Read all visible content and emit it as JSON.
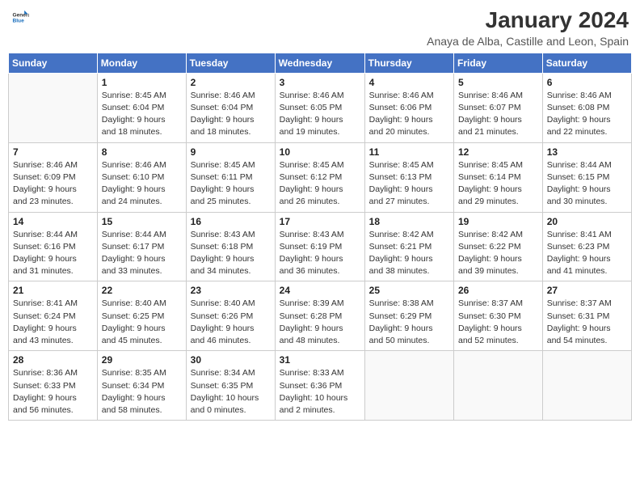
{
  "logo": {
    "general": "General",
    "blue": "Blue"
  },
  "header": {
    "month_year": "January 2024",
    "subtitle": "Anaya de Alba, Castille and Leon, Spain"
  },
  "weekdays": [
    "Sunday",
    "Monday",
    "Tuesday",
    "Wednesday",
    "Thursday",
    "Friday",
    "Saturday"
  ],
  "weeks": [
    [
      {
        "day": "",
        "info": ""
      },
      {
        "day": "1",
        "info": "Sunrise: 8:45 AM\nSunset: 6:04 PM\nDaylight: 9 hours\nand 18 minutes."
      },
      {
        "day": "2",
        "info": "Sunrise: 8:46 AM\nSunset: 6:04 PM\nDaylight: 9 hours\nand 18 minutes."
      },
      {
        "day": "3",
        "info": "Sunrise: 8:46 AM\nSunset: 6:05 PM\nDaylight: 9 hours\nand 19 minutes."
      },
      {
        "day": "4",
        "info": "Sunrise: 8:46 AM\nSunset: 6:06 PM\nDaylight: 9 hours\nand 20 minutes."
      },
      {
        "day": "5",
        "info": "Sunrise: 8:46 AM\nSunset: 6:07 PM\nDaylight: 9 hours\nand 21 minutes."
      },
      {
        "day": "6",
        "info": "Sunrise: 8:46 AM\nSunset: 6:08 PM\nDaylight: 9 hours\nand 22 minutes."
      }
    ],
    [
      {
        "day": "7",
        "info": "Sunrise: 8:46 AM\nSunset: 6:09 PM\nDaylight: 9 hours\nand 23 minutes."
      },
      {
        "day": "8",
        "info": "Sunrise: 8:46 AM\nSunset: 6:10 PM\nDaylight: 9 hours\nand 24 minutes."
      },
      {
        "day": "9",
        "info": "Sunrise: 8:45 AM\nSunset: 6:11 PM\nDaylight: 9 hours\nand 25 minutes."
      },
      {
        "day": "10",
        "info": "Sunrise: 8:45 AM\nSunset: 6:12 PM\nDaylight: 9 hours\nand 26 minutes."
      },
      {
        "day": "11",
        "info": "Sunrise: 8:45 AM\nSunset: 6:13 PM\nDaylight: 9 hours\nand 27 minutes."
      },
      {
        "day": "12",
        "info": "Sunrise: 8:45 AM\nSunset: 6:14 PM\nDaylight: 9 hours\nand 29 minutes."
      },
      {
        "day": "13",
        "info": "Sunrise: 8:44 AM\nSunset: 6:15 PM\nDaylight: 9 hours\nand 30 minutes."
      }
    ],
    [
      {
        "day": "14",
        "info": "Sunrise: 8:44 AM\nSunset: 6:16 PM\nDaylight: 9 hours\nand 31 minutes."
      },
      {
        "day": "15",
        "info": "Sunrise: 8:44 AM\nSunset: 6:17 PM\nDaylight: 9 hours\nand 33 minutes."
      },
      {
        "day": "16",
        "info": "Sunrise: 8:43 AM\nSunset: 6:18 PM\nDaylight: 9 hours\nand 34 minutes."
      },
      {
        "day": "17",
        "info": "Sunrise: 8:43 AM\nSunset: 6:19 PM\nDaylight: 9 hours\nand 36 minutes."
      },
      {
        "day": "18",
        "info": "Sunrise: 8:42 AM\nSunset: 6:21 PM\nDaylight: 9 hours\nand 38 minutes."
      },
      {
        "day": "19",
        "info": "Sunrise: 8:42 AM\nSunset: 6:22 PM\nDaylight: 9 hours\nand 39 minutes."
      },
      {
        "day": "20",
        "info": "Sunrise: 8:41 AM\nSunset: 6:23 PM\nDaylight: 9 hours\nand 41 minutes."
      }
    ],
    [
      {
        "day": "21",
        "info": "Sunrise: 8:41 AM\nSunset: 6:24 PM\nDaylight: 9 hours\nand 43 minutes."
      },
      {
        "day": "22",
        "info": "Sunrise: 8:40 AM\nSunset: 6:25 PM\nDaylight: 9 hours\nand 45 minutes."
      },
      {
        "day": "23",
        "info": "Sunrise: 8:40 AM\nSunset: 6:26 PM\nDaylight: 9 hours\nand 46 minutes."
      },
      {
        "day": "24",
        "info": "Sunrise: 8:39 AM\nSunset: 6:28 PM\nDaylight: 9 hours\nand 48 minutes."
      },
      {
        "day": "25",
        "info": "Sunrise: 8:38 AM\nSunset: 6:29 PM\nDaylight: 9 hours\nand 50 minutes."
      },
      {
        "day": "26",
        "info": "Sunrise: 8:37 AM\nSunset: 6:30 PM\nDaylight: 9 hours\nand 52 minutes."
      },
      {
        "day": "27",
        "info": "Sunrise: 8:37 AM\nSunset: 6:31 PM\nDaylight: 9 hours\nand 54 minutes."
      }
    ],
    [
      {
        "day": "28",
        "info": "Sunrise: 8:36 AM\nSunset: 6:33 PM\nDaylight: 9 hours\nand 56 minutes."
      },
      {
        "day": "29",
        "info": "Sunrise: 8:35 AM\nSunset: 6:34 PM\nDaylight: 9 hours\nand 58 minutes."
      },
      {
        "day": "30",
        "info": "Sunrise: 8:34 AM\nSunset: 6:35 PM\nDaylight: 10 hours\nand 0 minutes."
      },
      {
        "day": "31",
        "info": "Sunrise: 8:33 AM\nSunset: 6:36 PM\nDaylight: 10 hours\nand 2 minutes."
      },
      {
        "day": "",
        "info": ""
      },
      {
        "day": "",
        "info": ""
      },
      {
        "day": "",
        "info": ""
      }
    ]
  ]
}
